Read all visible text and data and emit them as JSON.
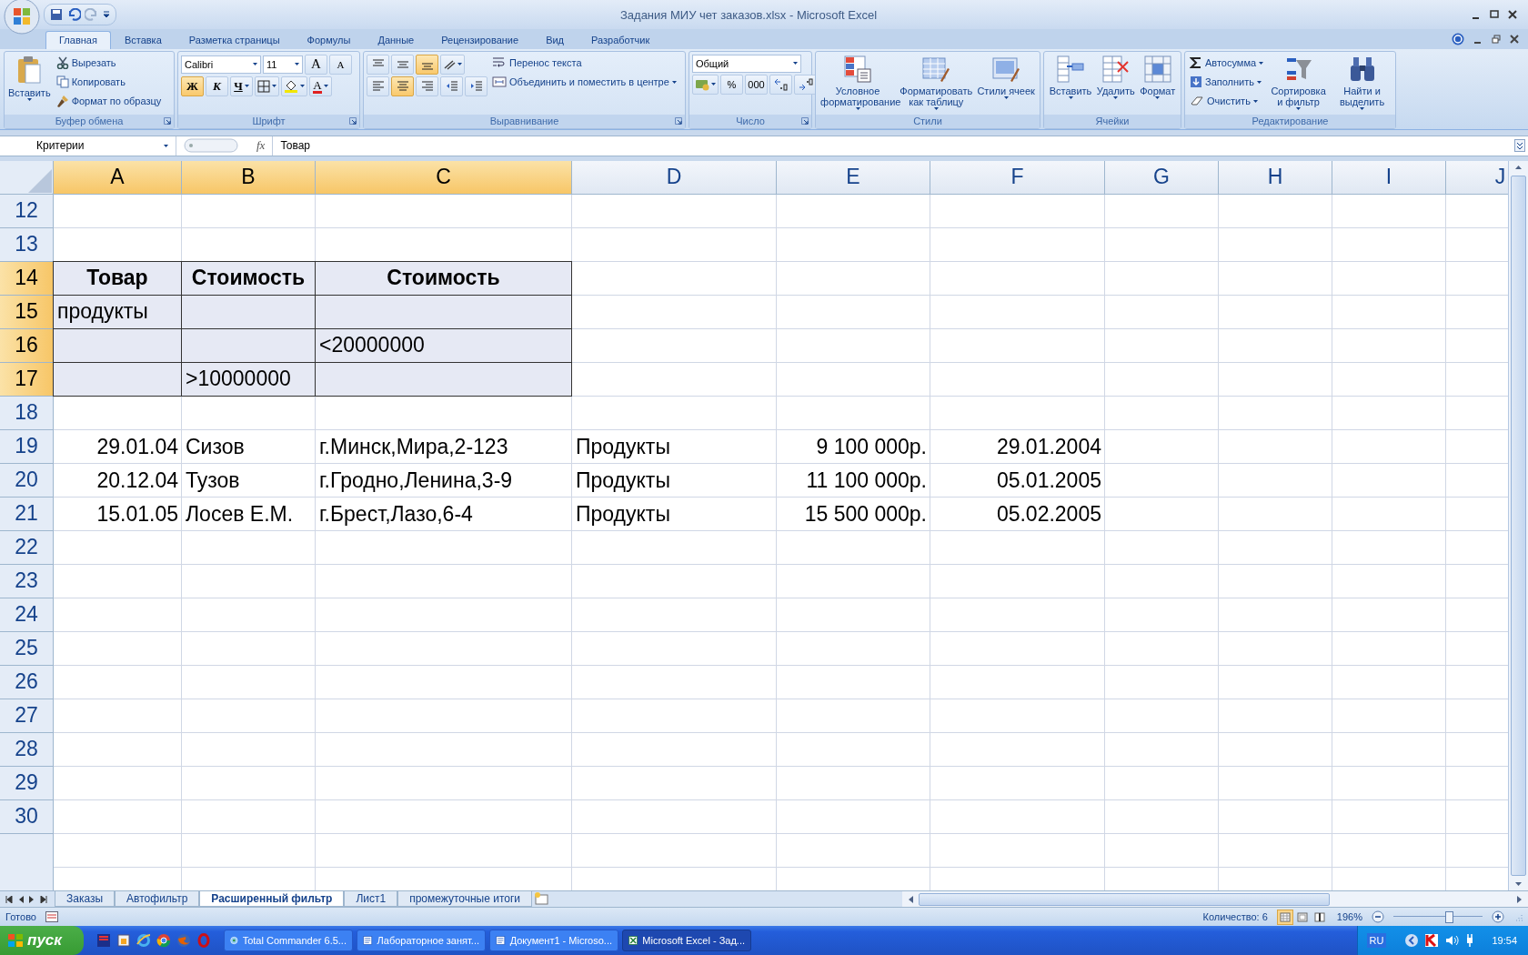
{
  "window": {
    "title": "Задания МИУ чет заказов.xlsx - Microsoft Excel"
  },
  "ribbon_tabs": [
    {
      "label": "Главная",
      "selected": true
    },
    {
      "label": "Вставка",
      "selected": false
    },
    {
      "label": "Разметка страницы",
      "selected": false
    },
    {
      "label": "Формулы",
      "selected": false
    },
    {
      "label": "Данные",
      "selected": false
    },
    {
      "label": "Рецензирование",
      "selected": false
    },
    {
      "label": "Вид",
      "selected": false
    },
    {
      "label": "Разработчик",
      "selected": false
    }
  ],
  "ribbon": {
    "groups": [
      {
        "label": "Буфер обмена",
        "launcher": true,
        "columns": [
          [
            [
              {
                "kind": "large",
                "label": "Вставить",
                "caret": true
              }
            ]
          ],
          [
            [
              {
                "kind": "small",
                "label": "Вырезать"
              }
            ],
            [
              {
                "kind": "small",
                "label": "Копировать"
              }
            ],
            [
              {
                "kind": "small",
                "label": "Формат по образцу"
              }
            ]
          ]
        ]
      },
      {
        "label": "Шрифт",
        "launcher": true,
        "columns": [
          [
            [
              {
                "kind": "combo",
                "value": "Calibri"
              },
              {
                "kind": "combo",
                "value": "11"
              },
              {
                "kind": "tool",
                "text": "A",
                "selected": false
              },
              {
                "kind": "tool",
                "text": "A",
                "selected": false
              }
            ],
            [
              {
                "kind": "tool",
                "text": "Ж",
                "selected": true
              },
              {
                "kind": "tool",
                "text": "К",
                "selected": false
              },
              {
                "kind": "tool",
                "text": "Ч",
                "caret": true,
                "selected": false
              },
              {
                "kind": "tool",
                "caret": true,
                "selected": false
              },
              {
                "kind": "tool",
                "caret": true,
                "selected": false
              },
              {
                "kind": "tool",
                "text": "A",
                "caret": true,
                "selected": false
              }
            ]
          ]
        ]
      },
      {
        "label": "Выравнивание",
        "launcher": true,
        "columns": [
          [
            [
              {
                "kind": "tool",
                "selected": false
              },
              {
                "kind": "tool",
                "selected": false
              },
              {
                "kind": "tool",
                "selected": true
              },
              {
                "kind": "tool",
                "caret": true,
                "selected": false
              }
            ],
            [
              {
                "kind": "tool",
                "selected": false
              },
              {
                "kind": "tool",
                "selected": true
              },
              {
                "kind": "tool",
                "selected": false
              },
              {
                "kind": "tool",
                "selected": false
              },
              {
                "kind": "tool",
                "selected": false
              }
            ]
          ],
          [
            [
              {
                "kind": "small",
                "label": "Перенос текста"
              }
            ],
            [
              {
                "kind": "small",
                "label": "Объединить и поместить в центре",
                "caret": true
              }
            ]
          ]
        ]
      },
      {
        "label": "Число",
        "launcher": true,
        "columns": [
          [
            [
              {
                "kind": "combo",
                "value": "Общий"
              }
            ],
            [
              {
                "kind": "tool",
                "caret": true,
                "selected": false
              },
              {
                "kind": "tool",
                "text": "%",
                "selected": false
              },
              {
                "kind": "tool",
                "text": "000",
                "selected": false
              },
              {
                "kind": "tool",
                "selected": false
              },
              {
                "kind": "tool",
                "selected": false
              }
            ]
          ]
        ]
      },
      {
        "label": "Стили",
        "launcher": false,
        "columns": [
          [
            [
              {
                "kind": "large",
                "label": "Условное форматирование",
                "caret": true
              }
            ]
          ],
          [
            [
              {
                "kind": "large",
                "label": "Форматировать как таблицу",
                "caret": true
              }
            ]
          ],
          [
            [
              {
                "kind": "large",
                "label": "Стили ячеек",
                "caret": true
              }
            ]
          ]
        ]
      },
      {
        "label": "Ячейки",
        "launcher": false,
        "columns": [
          [
            [
              {
                "kind": "large",
                "label": "Вставить",
                "caret": true
              }
            ]
          ],
          [
            [
              {
                "kind": "large",
                "label": "Удалить",
                "caret": true
              }
            ]
          ],
          [
            [
              {
                "kind": "large",
                "label": "Формат",
                "caret": true
              }
            ]
          ]
        ]
      },
      {
        "label": "Редактирование",
        "launcher": false,
        "columns": [
          [
            [
              {
                "kind": "small",
                "label": "Автосумма",
                "caret": true
              }
            ],
            [
              {
                "kind": "small",
                "label": "Заполнить",
                "caret": true
              }
            ],
            [
              {
                "kind": "small",
                "label": "Очистить",
                "caret": true
              }
            ]
          ],
          [
            [
              {
                "kind": "large",
                "label": "Сортировка и фильтр",
                "caret": true
              }
            ]
          ],
          [
            [
              {
                "kind": "large",
                "label": "Найти и выделить",
                "caret": true
              }
            ]
          ]
        ]
      }
    ]
  },
  "formula_bar": {
    "name_box": "Критерии",
    "function_label": "fx",
    "formula": "Товар"
  },
  "columns": [
    {
      "letter": "A",
      "selected": true
    },
    {
      "letter": "B",
      "selected": true
    },
    {
      "letter": "C",
      "selected": true
    },
    {
      "letter": "D",
      "selected": false
    },
    {
      "letter": "E",
      "selected": false
    },
    {
      "letter": "F",
      "selected": false
    },
    {
      "letter": "G",
      "selected": false
    },
    {
      "letter": "H",
      "selected": false
    },
    {
      "letter": "I",
      "selected": false
    },
    {
      "letter": "J",
      "selected": false
    }
  ],
  "rows": [
    {
      "number": "12",
      "selected": false,
      "cells": {}
    },
    {
      "number": "13",
      "selected": false,
      "cells": {}
    },
    {
      "number": "14",
      "selected": true,
      "cells": {
        "A": {
          "kind": "header",
          "text": "Товар"
        },
        "B": {
          "kind": "header",
          "text": "Стоимость"
        },
        "C": {
          "kind": "header",
          "text": "Стоимость"
        }
      }
    },
    {
      "number": "15",
      "selected": true,
      "cells": {
        "A": {
          "kind": "text",
          "text": "продукты"
        }
      }
    },
    {
      "number": "16",
      "selected": true,
      "cells": {
        "C": {
          "kind": "text",
          "text": "<20000000"
        }
      }
    },
    {
      "number": "17",
      "selected": true,
      "cells": {
        "B": {
          "kind": "text",
          "text": ">10000000"
        }
      }
    },
    {
      "number": "18",
      "selected": false,
      "cells": {}
    },
    {
      "number": "19",
      "selected": false,
      "cells": {
        "A": {
          "kind": "number",
          "text": "29.01.04"
        },
        "B": {
          "kind": "text",
          "text": "Сизов"
        },
        "C": {
          "kind": "text",
          "text": "г.Минск,Мира,2-123"
        },
        "D": {
          "kind": "text",
          "text": "Продукты"
        },
        "E": {
          "kind": "number",
          "text": "9 100 000р."
        },
        "F": {
          "kind": "number",
          "text": "29.01.2004"
        }
      }
    },
    {
      "number": "20",
      "selected": false,
      "cells": {
        "A": {
          "kind": "number",
          "text": "20.12.04"
        },
        "B": {
          "kind": "text",
          "text": "Тузов"
        },
        "C": {
          "kind": "text",
          "text": "г.Гродно,Ленина,3-9"
        },
        "D": {
          "kind": "text",
          "text": "Продукты"
        },
        "E": {
          "kind": "number",
          "text": "11 100 000р."
        },
        "F": {
          "kind": "number",
          "text": "05.01.2005"
        }
      }
    },
    {
      "number": "21",
      "selected": false,
      "cells": {
        "A": {
          "kind": "number",
          "text": "15.01.05"
        },
        "B": {
          "kind": "text",
          "text": "Лосев Е.М."
        },
        "C": {
          "kind": "text",
          "text": "г.Брест,Лазо,6-4"
        },
        "D": {
          "kind": "text",
          "text": "Продукты"
        },
        "E": {
          "kind": "number",
          "text": "15 500 000р."
        },
        "F": {
          "kind": "number",
          "text": "05.02.2005"
        }
      }
    },
    {
      "number": "22",
      "selected": false,
      "cells": {}
    },
    {
      "number": "23",
      "selected": false,
      "cells": {}
    },
    {
      "number": "24",
      "selected": false,
      "cells": {}
    },
    {
      "number": "25",
      "selected": false,
      "cells": {}
    },
    {
      "number": "26",
      "selected": false,
      "cells": {}
    },
    {
      "number": "27",
      "selected": false,
      "cells": {}
    },
    {
      "number": "28",
      "selected": false,
      "cells": {}
    },
    {
      "number": "29",
      "selected": false,
      "cells": {}
    },
    {
      "number": "30",
      "selected": false,
      "cells": {}
    }
  ],
  "sheet_tabs": [
    {
      "label": "Заказы",
      "selected": false
    },
    {
      "label": "Автофильтр",
      "selected": false
    },
    {
      "label": "Расширенный фильтр",
      "selected": true
    },
    {
      "label": "Лист1",
      "selected": false
    },
    {
      "label": "промежуточные итоги",
      "selected": false
    }
  ],
  "status_bar": {
    "mode": "Готово",
    "summary": "Количество: 6",
    "views": [
      {
        "selected": true
      },
      {
        "selected": false
      },
      {
        "selected": false
      }
    ],
    "zoom": "196%",
    "zoom_level": {
      "level": 0.62
    }
  },
  "taskbar": {
    "start": "пуск",
    "tasks": [
      {
        "label": "Total Commander 6.5...",
        "selected": false
      },
      {
        "label": "Лабораторное занят...",
        "selected": false
      },
      {
        "label": "Документ1 - Microso...",
        "selected": false
      },
      {
        "label": "Microsoft Excel - Зад...",
        "selected": true
      }
    ],
    "language": "RU",
    "clock": "19:54"
  }
}
